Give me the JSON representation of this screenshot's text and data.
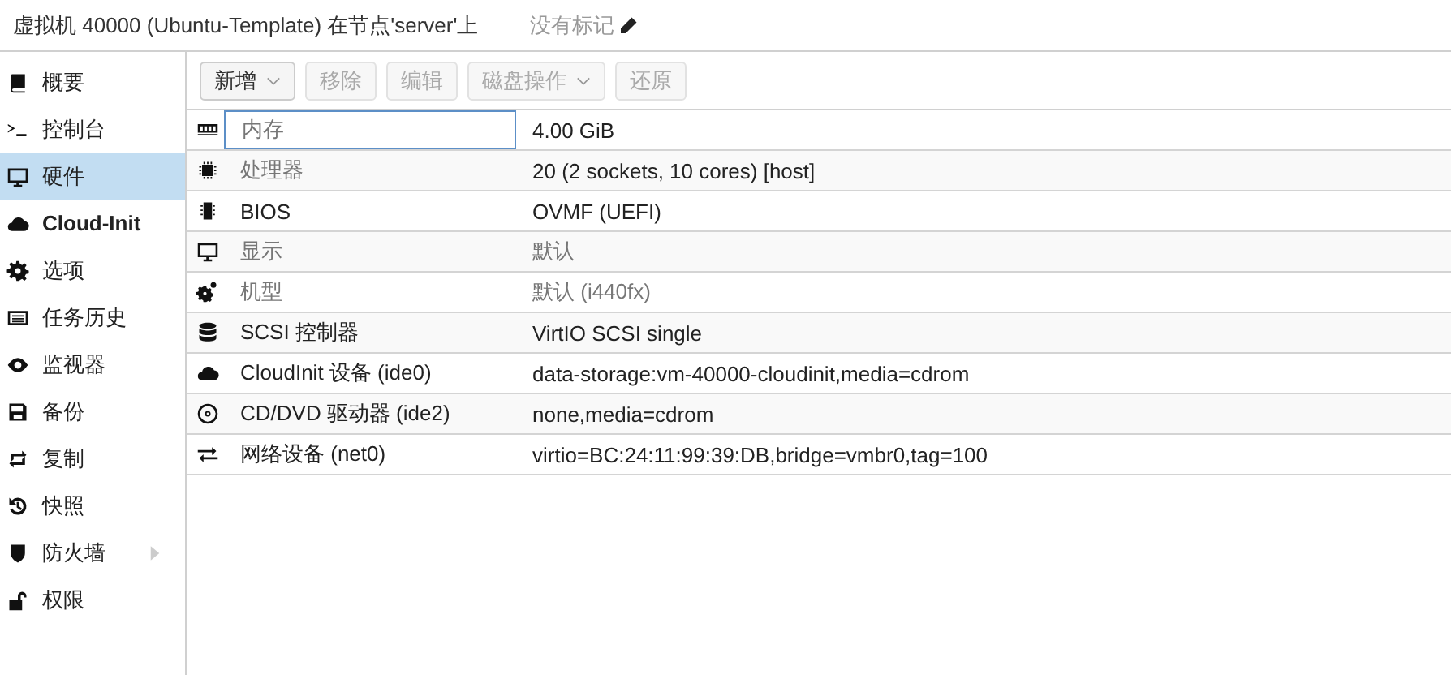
{
  "header": {
    "title": "虚拟机 40000 (Ubuntu-Template) 在节点'server'上",
    "tags": "没有标记"
  },
  "sidebar": {
    "items": [
      {
        "label": "概要",
        "selected": false
      },
      {
        "label": "控制台",
        "selected": false
      },
      {
        "label": "硬件",
        "selected": true
      },
      {
        "label": "Cloud-Init",
        "selected": false
      },
      {
        "label": "选项",
        "selected": false
      },
      {
        "label": "任务历史",
        "selected": false
      },
      {
        "label": "监视器",
        "selected": false
      },
      {
        "label": "备份",
        "selected": false
      },
      {
        "label": "复制",
        "selected": false
      },
      {
        "label": "快照",
        "selected": false
      },
      {
        "label": "防火墙",
        "selected": false,
        "expanded": false
      },
      {
        "label": "权限",
        "selected": false
      }
    ]
  },
  "toolbar": [
    {
      "label": "新增",
      "disabled": false,
      "dropdown": true
    },
    {
      "label": "移除",
      "disabled": true,
      "dropdown": false
    },
    {
      "label": "编辑",
      "disabled": true,
      "dropdown": false
    },
    {
      "label": "磁盘操作",
      "disabled": true,
      "dropdown": true
    },
    {
      "label": "还原",
      "disabled": true,
      "dropdown": false
    }
  ],
  "table": {
    "rows": [
      {
        "label": "内存",
        "value": "4.00 GiB",
        "label_muted": true,
        "value_muted": false,
        "focused": true
      },
      {
        "label": "处理器",
        "value": "20 (2 sockets, 10 cores) [host]",
        "label_muted": true,
        "value_muted": false,
        "focused": false
      },
      {
        "label": "BIOS",
        "value": "OVMF (UEFI)",
        "label_muted": false,
        "value_muted": false,
        "focused": false
      },
      {
        "label": "显示",
        "value": "默认",
        "label_muted": true,
        "value_muted": true,
        "focused": false
      },
      {
        "label": "机型",
        "value": "默认 (i440fx)",
        "label_muted": true,
        "value_muted": true,
        "focused": false
      },
      {
        "label": "SCSI 控制器",
        "value": "VirtIO SCSI single",
        "label_muted": false,
        "value_muted": false,
        "focused": false
      },
      {
        "label": "CloudInit 设备 (ide0)",
        "value": "data-storage:vm-40000-cloudinit,media=cdrom",
        "label_muted": false,
        "value_muted": false,
        "focused": false
      },
      {
        "label": "CD/DVD 驱动器 (ide2)",
        "value": "none,media=cdrom",
        "label_muted": false,
        "value_muted": false,
        "focused": false
      },
      {
        "label": "网络设备 (net0)",
        "value": "virtio=BC:24:11:99:39:DB,bridge=vmbr0,tag=100",
        "label_muted": false,
        "value_muted": false,
        "focused": false
      }
    ]
  }
}
